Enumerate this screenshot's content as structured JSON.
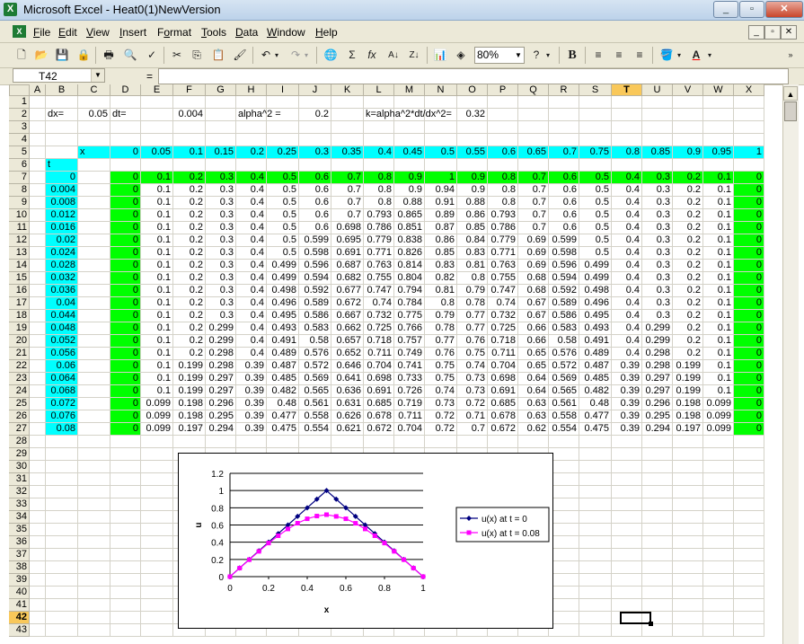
{
  "window": {
    "title": "Microsoft Excel - Heat0(1)NewVersion",
    "app_icon": "X"
  },
  "menu": [
    "File",
    "Edit",
    "View",
    "Insert",
    "Format",
    "Tools",
    "Data",
    "Window",
    "Help"
  ],
  "menu_access_keys": [
    "F",
    "E",
    "V",
    "I",
    "o",
    "T",
    "D",
    "W",
    "H"
  ],
  "toolbar": {
    "icons": [
      "new-icon",
      "open-icon",
      "save-icon",
      "permission-icon",
      "print-icon",
      "print-preview-icon",
      "spelling-icon",
      "cut-icon",
      "copy-icon",
      "paste-icon",
      "format-painter-icon",
      "undo-icon",
      "redo-icon",
      "hyperlink-icon",
      "autosum-icon",
      "function-icon",
      "sort-ascending-icon",
      "sort-descending-icon",
      "chart-wizard-icon",
      "drawing-icon"
    ],
    "zoom": "80%",
    "bold": "B",
    "font_color_letter": "A"
  },
  "formula_bar": {
    "name_box": "T42",
    "equals": "=",
    "formula": ""
  },
  "columns": [
    "A",
    "B",
    "C",
    "D",
    "E",
    "F",
    "G",
    "H",
    "I",
    "J",
    "K",
    "L",
    "M",
    "N",
    "O",
    "P",
    "Q",
    "R",
    "S",
    "T",
    "U",
    "V",
    "W",
    "X"
  ],
  "selected_column": "T",
  "selected_row": 42,
  "rows": [
    1,
    2,
    3,
    4,
    5,
    6,
    7,
    8,
    9,
    10,
    11,
    12,
    13,
    14,
    15,
    16,
    17,
    18,
    19,
    20,
    21,
    22,
    23,
    24,
    25,
    26,
    27,
    28,
    29,
    30,
    31,
    32,
    33,
    34,
    35,
    36,
    37,
    38,
    39,
    40,
    41,
    42,
    43
  ],
  "params": {
    "dx_label": "dx=",
    "dx": "0.05",
    "dt_label": "dt=",
    "dt": "0.004",
    "alpha_label": "alpha^2 =",
    "alpha": "0.2",
    "k_label": "k=alpha^2*dt/dx^2=",
    "k": "0.32"
  },
  "x_label": "x",
  "t_label": "t",
  "x_values": [
    "0",
    "0.05",
    "0.1",
    "0.15",
    "0.2",
    "0.25",
    "0.3",
    "0.35",
    "0.4",
    "0.45",
    "0.5",
    "0.55",
    "0.6",
    "0.65",
    "0.7",
    "0.75",
    "0.8",
    "0.85",
    "0.9",
    "0.95",
    "1"
  ],
  "t_values": [
    "0",
    "0.004",
    "0.008",
    "0.012",
    "0.016",
    "0.02",
    "0.024",
    "0.028",
    "0.032",
    "0.036",
    "0.04",
    "0.044",
    "0.048",
    "0.052",
    "0.056",
    "0.06",
    "0.064",
    "0.068",
    "0.072",
    "0.076",
    "0.08"
  ],
  "grid": [
    [
      "0",
      "0.1",
      "0.2",
      "0.3",
      "0.4",
      "0.5",
      "0.6",
      "0.7",
      "0.8",
      "0.9",
      "1",
      "0.9",
      "0.8",
      "0.7",
      "0.6",
      "0.5",
      "0.4",
      "0.3",
      "0.2",
      "0.1",
      "0"
    ],
    [
      "0",
      "0.1",
      "0.2",
      "0.3",
      "0.4",
      "0.5",
      "0.6",
      "0.7",
      "0.8",
      "0.9",
      "0.94",
      "0.9",
      "0.8",
      "0.7",
      "0.6",
      "0.5",
      "0.4",
      "0.3",
      "0.2",
      "0.1",
      "0"
    ],
    [
      "0",
      "0.1",
      "0.2",
      "0.3",
      "0.4",
      "0.5",
      "0.6",
      "0.7",
      "0.8",
      "0.88",
      "0.91",
      "0.88",
      "0.8",
      "0.7",
      "0.6",
      "0.5",
      "0.4",
      "0.3",
      "0.2",
      "0.1",
      "0"
    ],
    [
      "0",
      "0.1",
      "0.2",
      "0.3",
      "0.4",
      "0.5",
      "0.6",
      "0.7",
      "0.793",
      "0.865",
      "0.89",
      "0.86",
      "0.793",
      "0.7",
      "0.6",
      "0.5",
      "0.4",
      "0.3",
      "0.2",
      "0.1",
      "0"
    ],
    [
      "0",
      "0.1",
      "0.2",
      "0.3",
      "0.4",
      "0.5",
      "0.6",
      "0.698",
      "0.786",
      "0.851",
      "0.87",
      "0.85",
      "0.786",
      "0.7",
      "0.6",
      "0.5",
      "0.4",
      "0.3",
      "0.2",
      "0.1",
      "0"
    ],
    [
      "0",
      "0.1",
      "0.2",
      "0.3",
      "0.4",
      "0.5",
      "0.599",
      "0.695",
      "0.779",
      "0.838",
      "0.86",
      "0.84",
      "0.779",
      "0.69",
      "0.599",
      "0.5",
      "0.4",
      "0.3",
      "0.2",
      "0.1",
      "0"
    ],
    [
      "0",
      "0.1",
      "0.2",
      "0.3",
      "0.4",
      "0.5",
      "0.598",
      "0.691",
      "0.771",
      "0.826",
      "0.85",
      "0.83",
      "0.771",
      "0.69",
      "0.598",
      "0.5",
      "0.4",
      "0.3",
      "0.2",
      "0.1",
      "0"
    ],
    [
      "0",
      "0.1",
      "0.2",
      "0.3",
      "0.4",
      "0.499",
      "0.596",
      "0.687",
      "0.763",
      "0.814",
      "0.83",
      "0.81",
      "0.763",
      "0.69",
      "0.596",
      "0.499",
      "0.4",
      "0.3",
      "0.2",
      "0.1",
      "0"
    ],
    [
      "0",
      "0.1",
      "0.2",
      "0.3",
      "0.4",
      "0.499",
      "0.594",
      "0.682",
      "0.755",
      "0.804",
      "0.82",
      "0.8",
      "0.755",
      "0.68",
      "0.594",
      "0.499",
      "0.4",
      "0.3",
      "0.2",
      "0.1",
      "0"
    ],
    [
      "0",
      "0.1",
      "0.2",
      "0.3",
      "0.4",
      "0.498",
      "0.592",
      "0.677",
      "0.747",
      "0.794",
      "0.81",
      "0.79",
      "0.747",
      "0.68",
      "0.592",
      "0.498",
      "0.4",
      "0.3",
      "0.2",
      "0.1",
      "0"
    ],
    [
      "0",
      "0.1",
      "0.2",
      "0.3",
      "0.4",
      "0.496",
      "0.589",
      "0.672",
      "0.74",
      "0.784",
      "0.8",
      "0.78",
      "0.74",
      "0.67",
      "0.589",
      "0.496",
      "0.4",
      "0.3",
      "0.2",
      "0.1",
      "0"
    ],
    [
      "0",
      "0.1",
      "0.2",
      "0.3",
      "0.4",
      "0.495",
      "0.586",
      "0.667",
      "0.732",
      "0.775",
      "0.79",
      "0.77",
      "0.732",
      "0.67",
      "0.586",
      "0.495",
      "0.4",
      "0.3",
      "0.2",
      "0.1",
      "0"
    ],
    [
      "0",
      "0.1",
      "0.2",
      "0.299",
      "0.4",
      "0.493",
      "0.583",
      "0.662",
      "0.725",
      "0.766",
      "0.78",
      "0.77",
      "0.725",
      "0.66",
      "0.583",
      "0.493",
      "0.4",
      "0.299",
      "0.2",
      "0.1",
      "0"
    ],
    [
      "0",
      "0.1",
      "0.2",
      "0.299",
      "0.4",
      "0.491",
      "0.58",
      "0.657",
      "0.718",
      "0.757",
      "0.77",
      "0.76",
      "0.718",
      "0.66",
      "0.58",
      "0.491",
      "0.4",
      "0.299",
      "0.2",
      "0.1",
      "0"
    ],
    [
      "0",
      "0.1",
      "0.2",
      "0.298",
      "0.4",
      "0.489",
      "0.576",
      "0.652",
      "0.711",
      "0.749",
      "0.76",
      "0.75",
      "0.711",
      "0.65",
      "0.576",
      "0.489",
      "0.4",
      "0.298",
      "0.2",
      "0.1",
      "0"
    ],
    [
      "0",
      "0.1",
      "0.199",
      "0.298",
      "0.39",
      "0.487",
      "0.572",
      "0.646",
      "0.704",
      "0.741",
      "0.75",
      "0.74",
      "0.704",
      "0.65",
      "0.572",
      "0.487",
      "0.39",
      "0.298",
      "0.199",
      "0.1",
      "0"
    ],
    [
      "0",
      "0.1",
      "0.199",
      "0.297",
      "0.39",
      "0.485",
      "0.569",
      "0.641",
      "0.698",
      "0.733",
      "0.75",
      "0.73",
      "0.698",
      "0.64",
      "0.569",
      "0.485",
      "0.39",
      "0.297",
      "0.199",
      "0.1",
      "0"
    ],
    [
      "0",
      "0.1",
      "0.199",
      "0.297",
      "0.39",
      "0.482",
      "0.565",
      "0.636",
      "0.691",
      "0.726",
      "0.74",
      "0.73",
      "0.691",
      "0.64",
      "0.565",
      "0.482",
      "0.39",
      "0.297",
      "0.199",
      "0.1",
      "0"
    ],
    [
      "0",
      "0.099",
      "0.198",
      "0.296",
      "0.39",
      "0.48",
      "0.561",
      "0.631",
      "0.685",
      "0.719",
      "0.73",
      "0.72",
      "0.685",
      "0.63",
      "0.561",
      "0.48",
      "0.39",
      "0.296",
      "0.198",
      "0.099",
      "0"
    ],
    [
      "0",
      "0.099",
      "0.198",
      "0.295",
      "0.39",
      "0.477",
      "0.558",
      "0.626",
      "0.678",
      "0.711",
      "0.72",
      "0.71",
      "0.678",
      "0.63",
      "0.558",
      "0.477",
      "0.39",
      "0.295",
      "0.198",
      "0.099",
      "0"
    ],
    [
      "0",
      "0.099",
      "0.197",
      "0.294",
      "0.39",
      "0.475",
      "0.554",
      "0.621",
      "0.672",
      "0.704",
      "0.72",
      "0.7",
      "0.672",
      "0.62",
      "0.554",
      "0.475",
      "0.39",
      "0.294",
      "0.197",
      "0.099",
      "0"
    ]
  ],
  "colors": {
    "cyan": "#00ffff",
    "green": "#00ff00",
    "series1": "#000080",
    "series2": "#ff00ff",
    "header_selected": "#f9c85a"
  },
  "chart_data": {
    "type": "line",
    "xlabel": "x",
    "ylabel": "u",
    "xlim": [
      0,
      1
    ],
    "ylim": [
      0,
      1.2
    ],
    "x_ticks": [
      "0",
      "0.2",
      "0.4",
      "0.6",
      "0.8",
      "1"
    ],
    "y_ticks": [
      "0",
      "0.2",
      "0.4",
      "0.6",
      "0.8",
      "1",
      "1.2"
    ],
    "x": [
      0,
      0.05,
      0.1,
      0.15,
      0.2,
      0.25,
      0.3,
      0.35,
      0.4,
      0.45,
      0.5,
      0.55,
      0.6,
      0.65,
      0.7,
      0.75,
      0.8,
      0.85,
      0.9,
      0.95,
      1
    ],
    "series": [
      {
        "name": "u(x) at t = 0",
        "values": [
          0,
          0.1,
          0.2,
          0.3,
          0.4,
          0.5,
          0.6,
          0.7,
          0.8,
          0.9,
          1,
          0.9,
          0.8,
          0.7,
          0.6,
          0.5,
          0.4,
          0.3,
          0.2,
          0.1,
          0
        ]
      },
      {
        "name": "u(x) at t = 0.08",
        "values": [
          0,
          0.099,
          0.197,
          0.294,
          0.39,
          0.475,
          0.554,
          0.621,
          0.672,
          0.704,
          0.72,
          0.7,
          0.672,
          0.62,
          0.554,
          0.475,
          0.39,
          0.294,
          0.197,
          0.099,
          0
        ]
      }
    ],
    "legend": "right",
    "grid": true
  }
}
